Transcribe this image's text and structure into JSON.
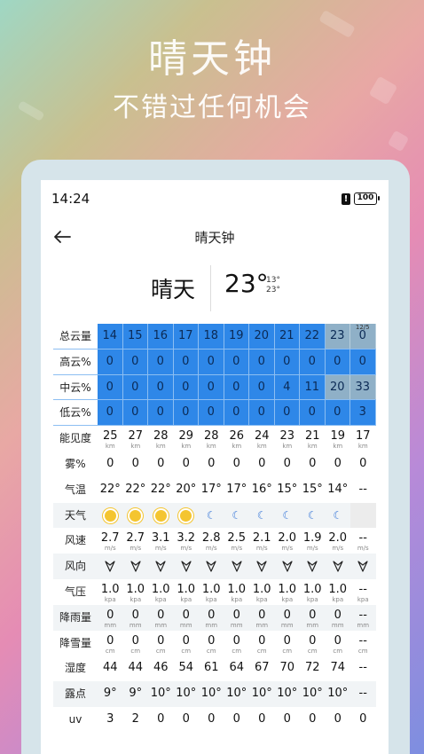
{
  "promo": {
    "title": "晴天钟",
    "subtitle": "不错过任何机会"
  },
  "status": {
    "time": "14:24",
    "alert": "!",
    "battery": "100"
  },
  "nav": {
    "title": "晴天钟"
  },
  "summary": {
    "condition": "晴天",
    "temp": "23°",
    "low": "13°",
    "high": "23°"
  },
  "colors": {
    "cloud_blue": "#2e87e8",
    "cloud_grey": "#8fb0c7"
  },
  "table": {
    "cloud_rows": [
      {
        "label": "总云量",
        "values": [
          "14",
          "15",
          "16",
          "17",
          "18",
          "19",
          "20",
          "21",
          "22",
          "23",
          "0"
        ],
        "grey": [
          false,
          false,
          false,
          false,
          false,
          false,
          false,
          false,
          false,
          true,
          true
        ],
        "top_note": {
          "index": 10,
          "text": "12/5"
        }
      },
      {
        "label": "高云%",
        "values": [
          "0",
          "0",
          "0",
          "0",
          "0",
          "0",
          "0",
          "0",
          "0",
          "0",
          "0"
        ],
        "grey": [
          false,
          false,
          false,
          false,
          false,
          false,
          false,
          false,
          false,
          false,
          false
        ]
      },
      {
        "label": "中云%",
        "values": [
          "0",
          "0",
          "0",
          "0",
          "0",
          "0",
          "0",
          "0",
          "4",
          "11",
          "20",
          "33"
        ],
        "grey": [
          false,
          false,
          false,
          false,
          false,
          false,
          false,
          false,
          false,
          false,
          true,
          true
        ]
      },
      {
        "label": "低云%",
        "values": [
          "1",
          "0",
          "0",
          "0",
          "0",
          "0",
          "0",
          "0",
          "0",
          "0",
          "0",
          "3"
        ],
        "grey": [
          false,
          false,
          false,
          false,
          false,
          false,
          false,
          false,
          false,
          false,
          false,
          false
        ]
      }
    ],
    "visibility": {
      "label": "能见度",
      "values": [
        "25",
        "27",
        "28",
        "29",
        "28",
        "26",
        "24",
        "23",
        "21",
        "19",
        "17"
      ],
      "unit": "km"
    },
    "fog": {
      "label": "雾%",
      "values": [
        "0",
        "0",
        "0",
        "0",
        "0",
        "0",
        "0",
        "0",
        "0",
        "0",
        "0"
      ]
    },
    "temp": {
      "label": "气温",
      "values": [
        "22°",
        "22°",
        "22°",
        "20°",
        "17°",
        "17°",
        "16°",
        "15°",
        "15°",
        "14°",
        "--"
      ]
    },
    "weather": {
      "label": "天气",
      "icons": [
        "sun-icon",
        "sun-icon",
        "sun-icon",
        "sun-icon",
        "moon-icon",
        "moon-icon",
        "moon-icon",
        "moon-icon",
        "moon-icon",
        "moon-icon",
        ""
      ]
    },
    "wind_speed": {
      "label": "风速",
      "values": [
        "2.7",
        "2.7",
        "3.1",
        "3.2",
        "2.8",
        "2.5",
        "2.1",
        "2.0",
        "1.9",
        "2.0",
        "--"
      ],
      "unit": "m/s"
    },
    "wind_dir": {
      "label": "风向",
      "icons": [
        "wind-dir-icon",
        "wind-dir-icon",
        "wind-dir-icon",
        "wind-dir-icon",
        "wind-dir-icon",
        "wind-dir-icon",
        "wind-dir-icon",
        "wind-dir-icon",
        "wind-dir-icon",
        "wind-dir-icon",
        "wind-dir-icon"
      ]
    },
    "pressure": {
      "label": "气压",
      "values": [
        "1.0",
        "1.0",
        "1.0",
        "1.0",
        "1.0",
        "1.0",
        "1.0",
        "1.0",
        "1.0",
        "1.0",
        "--"
      ],
      "unit": "kpa"
    },
    "rain": {
      "label": "降雨量",
      "values": [
        "0",
        "0",
        "0",
        "0",
        "0",
        "0",
        "0",
        "0",
        "0",
        "0",
        "--"
      ],
      "unit": "mm"
    },
    "snow": {
      "label": "降雪量",
      "values": [
        "0",
        "0",
        "0",
        "0",
        "0",
        "0",
        "0",
        "0",
        "0",
        "0",
        "--"
      ],
      "unit": "cm"
    },
    "humidity": {
      "label": "湿度",
      "values": [
        "44",
        "44",
        "46",
        "54",
        "61",
        "64",
        "67",
        "70",
        "72",
        "74",
        "--"
      ]
    },
    "dew": {
      "label": "露点",
      "values": [
        "9°",
        "9°",
        "10°",
        "10°",
        "10°",
        "10°",
        "10°",
        "10°",
        "10°",
        "10°",
        "--"
      ]
    },
    "uv": {
      "label": "uv",
      "values": [
        "3",
        "2",
        "0",
        "0",
        "0",
        "0",
        "0",
        "0",
        "0",
        "0",
        "0"
      ]
    }
  }
}
